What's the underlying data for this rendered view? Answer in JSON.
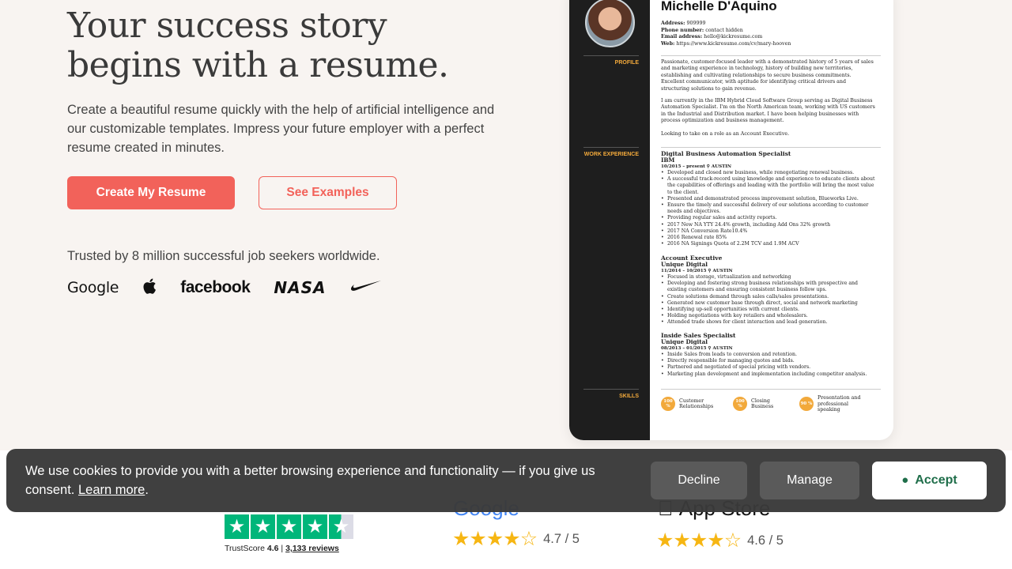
{
  "hero": {
    "headline_line1": "Your success story",
    "headline_line2": "begins with a resume.",
    "subtext": "Create a beautiful resume quickly with the help of artificial intelligence and our customizable templates. Impress your future employer with a perfect resume created in minutes.",
    "primary_cta": "Create My Resume",
    "secondary_cta": "See Examples",
    "trusted_text": "Trusted by 8 million successful job seekers worldwide.",
    "logos": [
      "Google",
      "apple-icon",
      "facebook",
      "NASA",
      "nike-icon"
    ]
  },
  "resume": {
    "name": "Michelle D'Aquino",
    "address_label": "Address:",
    "address": "909999",
    "phone_label": "Phone number:",
    "phone": "contact hidden",
    "email_label": "Email address:",
    "email": "hello@kickresume.com",
    "web_label": "Web:",
    "web": "https://www.kickresume.com/cv/mary-hooven",
    "side_labels": {
      "profile": "PROFILE",
      "work": "WORK EXPERIENCE",
      "skills": "SKILLS"
    },
    "profile_p1": "Passionate, customer-focused leader with a demonstrated history of 5 years of sales and marketing experience in technology, history of building new territories, establishing and cultivating relationships to secure business commitments. Excellent communicator, with aptitude for identifying critical drivers and structuring solutions to gain revenue.",
    "profile_p2": "I am currently in the IBM Hybrid Cloud Software Group serving as Digital Business Automation Specialist. I'm on the North American team, working with US customers in the Industrial and Distribution market. I have been helping businesses with process optimization and business management.",
    "profile_p3": "Looking to take on a role as an Account Executive.",
    "jobs": [
      {
        "title": "Digital Business Automation Specialist",
        "company": "IBM",
        "dates": "10/2015 – present  ⚲ AUSTIN",
        "bullets": [
          "Developed and closed new business, while renegotiating renewal business.",
          "A successful track-record using knowledge and experience to educate clients about the capabilities of offerings and leading with the portfolio will bring the most value to the client.",
          "Presented and demonstrated process improvement solution, Blueworks Live.",
          "Ensure the timely and successful delivery of our solutions according to customer needs and objectives.",
          "Providing regular sales and activity reports.",
          "2017 New NA YTY 24.4% growth, including Add Ons 32% growth",
          "2017 NA Conversion Rate10.4%",
          "2016 Renewal rate 85%",
          "2016 NA Signings Quota of 2.2M TCV and 1.9M ACV"
        ]
      },
      {
        "title": "Account Executive",
        "company": "Unique Digital",
        "dates": "11/2014 – 10/2015  ⚲ AUSTIN",
        "bullets": [
          "Focused in storage, virtualization and networking",
          "Developing and fostering strong business relationships with prospective and existing customers and ensuring consistent business follow ups.",
          "Create solutions demand through sales calls/sales presentations.",
          "Generated new customer base through direct, social and network marketing",
          "Identifying up-sell opportunities with current clients.",
          "Holding negotiations with key retailers and wholesalers.",
          "Attended trade shows for client interaction and lead generation."
        ]
      },
      {
        "title": "Inside Sales Specialist",
        "company": "Unique Digital",
        "dates": "08/2013 – 01/2015  ⚲ AUSTIN",
        "bullets": [
          "Inside Sales from leads to conversion and retention.",
          "Directly responsible for managing quotes and bids.",
          "Partnered and negotiated of special pricing with vendors.",
          "Marketing plan development and implementation including competitor analysis."
        ]
      }
    ],
    "skills": [
      {
        "pct": "100 %",
        "label": "Customer Relationships"
      },
      {
        "pct": "100 %",
        "label": "Closing Business"
      },
      {
        "pct": "90 %",
        "label": "Presentation and professional speaking"
      }
    ]
  },
  "ratings": {
    "trustpilot_score_label": "TrustScore",
    "trustpilot_score": "4.6",
    "trustpilot_separator": "|",
    "trustpilot_reviews": "3,133 reviews",
    "google_partial": "Google",
    "google_score": "4.7 / 5",
    "appstore_label": "App Store",
    "appstore_score": "4.6 / 5"
  },
  "cookie": {
    "text": "We use cookies to provide you with a better browsing experience and functionality — if you give us consent.",
    "learn_more": "Learn more",
    "period": ".",
    "decline": "Decline",
    "manage": "Manage",
    "accept": "Accept"
  },
  "colors": {
    "accent": "#f2625a",
    "hero_bg": "#f8f4f1",
    "resume_sidebar": "#1e1e1e",
    "resume_highlight": "#f2a93b",
    "star": "#f6b613",
    "trustpilot": "#00b67a",
    "cookie_bg": "#3a3a3a",
    "accept_text": "#1f6e4a"
  }
}
